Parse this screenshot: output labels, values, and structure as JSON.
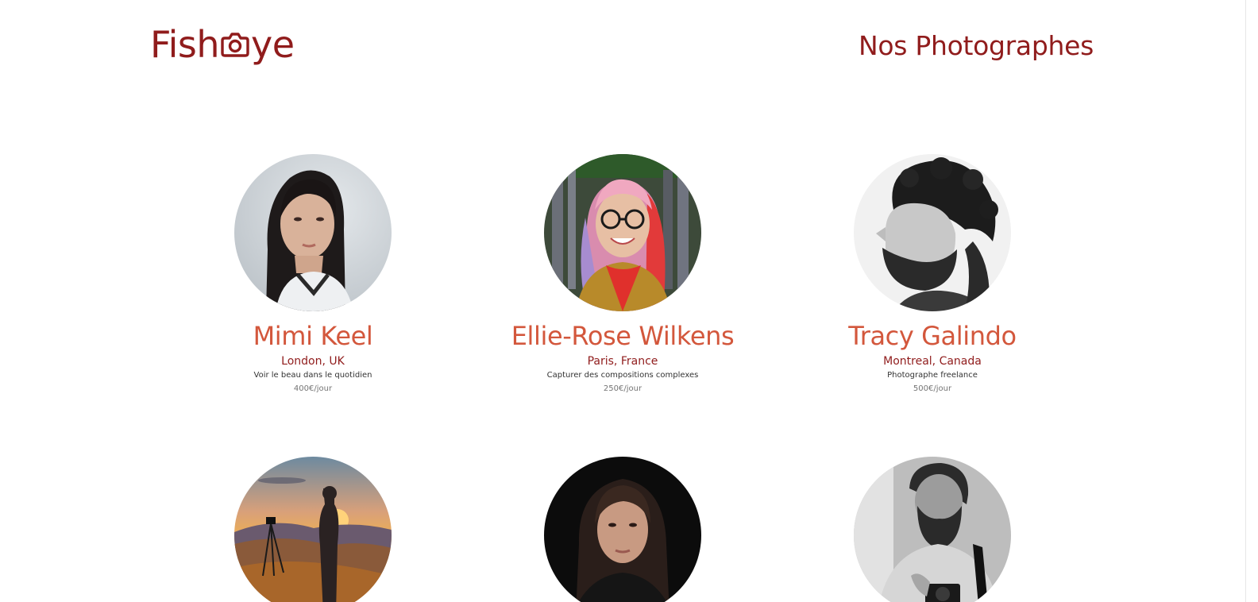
{
  "header": {
    "logo_left": "Fish",
    "logo_right": "ye",
    "title": "Nos Photographes"
  },
  "colors": {
    "brand": "#901c1c",
    "name": "#d3573c",
    "tagline": "#333333",
    "price": "#757575"
  },
  "photographers": [
    {
      "name": "Mimi Keel",
      "location": "London, UK",
      "tagline": "Voir le beau dans le quotidien",
      "price": "400€/jour",
      "portrait": "woman-long-dark-hair-portrait"
    },
    {
      "name": "Ellie-Rose Wilkens",
      "location": "Paris, France",
      "tagline": "Capturer des compositions complexes",
      "price": "250€/jour",
      "portrait": "woman-glasses-pink-hair-portrait"
    },
    {
      "name": "Tracy Galindo",
      "location": "Montreal, Canada",
      "tagline": "Photographe freelance",
      "price": "500€/jour",
      "portrait": "bearded-man-curly-hair-bw-portrait"
    },
    {
      "portrait": "photographer-sunset-landscape"
    },
    {
      "portrait": "woman-dark-background-portrait"
    },
    {
      "portrait": "bearded-man-camera-bw-portrait"
    }
  ]
}
